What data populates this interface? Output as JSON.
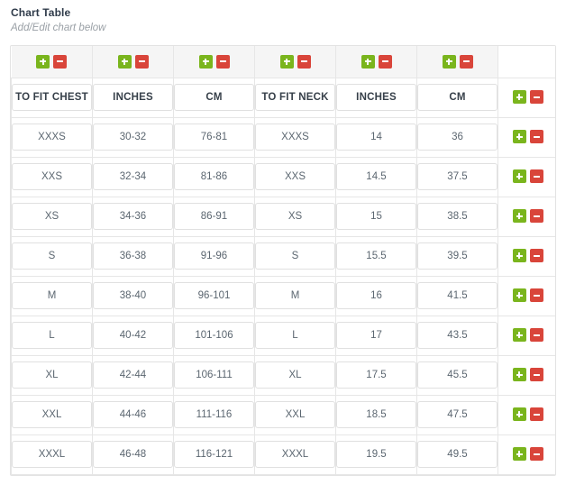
{
  "panel": {
    "title": "Chart Table",
    "subtitle": "Add/Edit chart below"
  },
  "buttons": {
    "add_label": "+",
    "remove_label": "-",
    "add_name": "plus-icon",
    "remove_name": "minus-icon"
  },
  "colors": {
    "add_green": "#7ab51d",
    "remove_red": "#d9453a",
    "header_bg": "#f5f5f5",
    "row_action_bg": "#f7f7f7",
    "border": "#e6e6e6",
    "field_border": "#e0e0e0",
    "title_text": "#2f3b4a",
    "subtitle_text": "#9aa0a6",
    "cell_text": "#5b6670"
  },
  "chart_data": {
    "type": "table",
    "title": "Chart Table",
    "columns": [
      "TO FIT CHEST",
      "INCHES",
      "CM",
      "TO FIT NECK",
      "INCHES",
      "CM"
    ],
    "rows": [
      [
        "XXXS",
        "30-32",
        "76-81",
        "XXXS",
        "14",
        "36"
      ],
      [
        "XXS",
        "32-34",
        "81-86",
        "XXS",
        "14.5",
        "37.5"
      ],
      [
        "XS",
        "34-36",
        "86-91",
        "XS",
        "15",
        "38.5"
      ],
      [
        "S",
        "36-38",
        "91-96",
        "S",
        "15.5",
        "39.5"
      ],
      [
        "M",
        "38-40",
        "96-101",
        "M",
        "16",
        "41.5"
      ],
      [
        "L",
        "40-42",
        "101-106",
        "L",
        "17",
        "43.5"
      ],
      [
        "XL",
        "42-44",
        "106-111",
        "XL",
        "17.5",
        "45.5"
      ],
      [
        "XXL",
        "44-46",
        "111-116",
        "XXL",
        "18.5",
        "47.5"
      ],
      [
        "XXXL",
        "46-48",
        "116-121",
        "XXXL",
        "19.5",
        "49.5"
      ]
    ]
  }
}
